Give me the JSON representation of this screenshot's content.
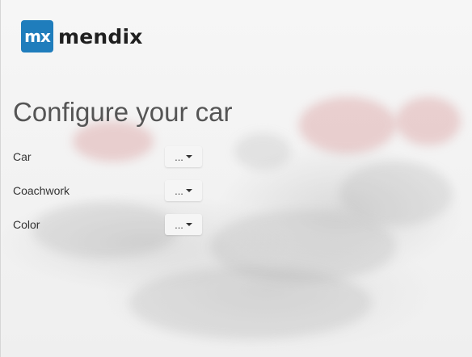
{
  "header": {
    "logo_mark": "mx",
    "logo_text": "mendix"
  },
  "main": {
    "title": "Configure your car",
    "fields": [
      {
        "label": "Car",
        "value": "..."
      },
      {
        "label": "Coachwork",
        "value": "..."
      },
      {
        "label": "Color",
        "value": "..."
      }
    ]
  },
  "icons": {
    "dropdown": "caret-down-icon"
  },
  "colors": {
    "brand": "#1f7dbc",
    "title": "#555555"
  }
}
